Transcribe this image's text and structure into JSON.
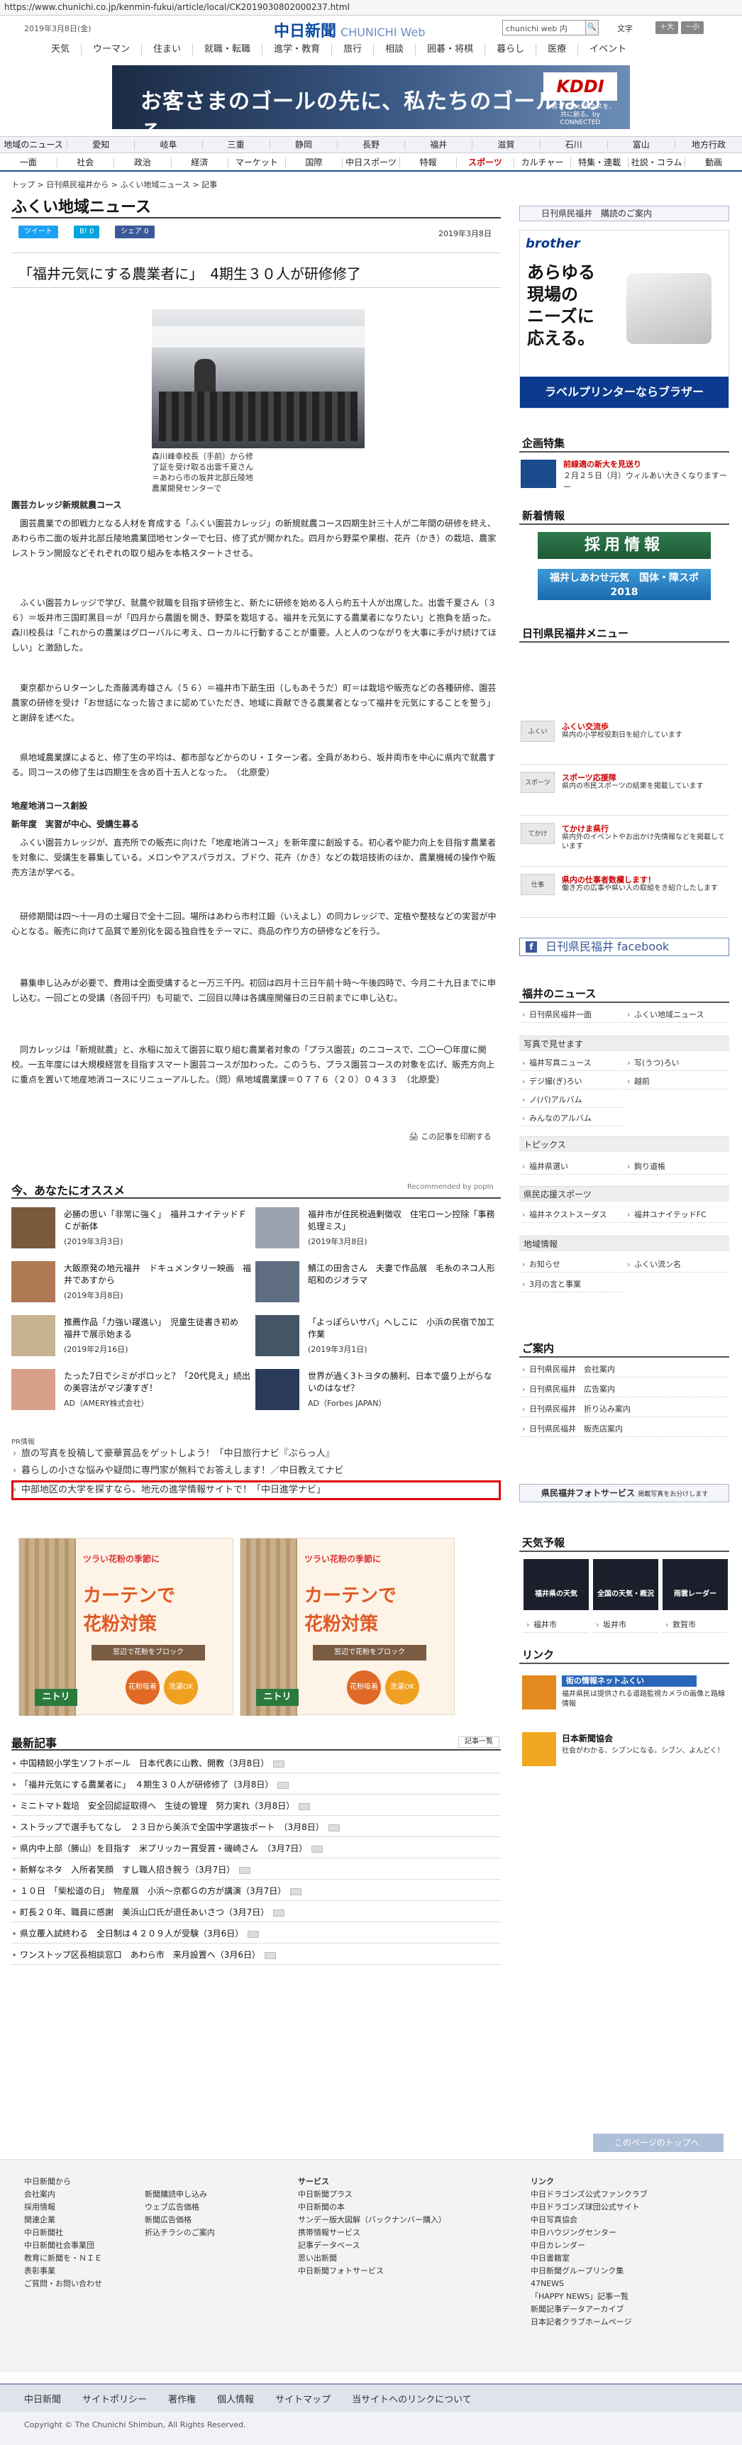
{
  "browser": {
    "url": "https://www.chunichi.co.jp/kenmin-fukui/article/local/CK2019030802000237.html"
  },
  "header": {
    "date": "2019年3月8日(金)",
    "logo_main": "中日新聞",
    "logo_sub": "CHUNICHI Web",
    "search_placeholder": "chunichi web 内",
    "search_btn": "🔍",
    "font_label": "文字",
    "font_big": "大",
    "font_small": "小",
    "nav": [
      "天気",
      "ウーマン",
      "住まい",
      "就職・転職",
      "進学・教育",
      "旅行",
      "相談",
      "囲碁・将棋",
      "暮らし",
      "医療",
      "イベント"
    ]
  },
  "ad_banner": {
    "text": "お客さまのゴールの先に、私たちのゴールはある。",
    "brand": "KDDI",
    "brand_sub": "お客さまのビジネスを、共に創る。by CONNECTED"
  },
  "region_nav": {
    "row1": [
      "地域のニュース",
      "愛知",
      "岐阜",
      "三重",
      "静岡",
      "長野",
      "福井",
      "滋賀",
      "石川",
      "富山",
      "地方行政"
    ],
    "row2": [
      "一面",
      "社会",
      "政治",
      "経済",
      "マーケット",
      "国際",
      "中日スポーツ",
      "特報",
      "スポーツ",
      "カルチャー",
      "特集・連載",
      "社説・コラム",
      "動画"
    ],
    "row2_active": "スポーツ"
  },
  "breadcrumb": "トップ > 日刊県民福井から > ふくい地域ニュース > 記事",
  "page_title": "ふくい地域ニュース",
  "share": {
    "tweet": "ツイート",
    "b": "B! 0",
    "fb": "シェア 0"
  },
  "article": {
    "date": "2019年3月8日",
    "title": "「福井元気にする農業者に」　4期生３０人が研修修了",
    "caption": "森川峰幸校長（手前）から修了証を受け取る出雲千夏さん＝あわら市の坂井北部丘陵地農業開発センターで",
    "sub1": "園芸カレッジ新規就農コース",
    "p1": "　園芸農業での即戦力となる人材を育成する「ふくい園芸カレッジ」の新規就農コース四期生計三十人が二年間の研修を終え、あわら市二面の坂井北部丘陵地農業団地センターで七日、修了式が開かれた。四月から野菜や果樹、花卉（かき）の栽培、農家レストラン開設などそれぞれの取り組みを本格スタートさせる。",
    "p2": "　ふくい園芸カレッジで学び、就農や就職を目指す研修生と、新たに研修を始める人ら約五十人が出席した。出雲千夏さん（３６）＝坂井市三国町黒目＝が「四月から農園を開き、野菜を栽培する。福井を元気にする農業者になりたい」と抱負を語った。森川校長は「これからの農業はグローバルに考え、ローカルに行動することが重要。人と人のつながりを大事に手がけ続けてほしい」と激励した。",
    "p3": "　東京都からＵターンした斎藤満寿雄さん（５６）＝福井市下莇生田（しもあそうだ）町＝は栽培や販売などの各種研修、園芸農家の研修を受け「お世話になった皆さまに認めていただき、地域に貢献できる農業者となって福井を元気にすることを誓う」と謝辞を述べた。",
    "p4": "　県地域農業課によると、修了生の平均は、都市部などからのＵ・Ｉターン者。全員があわら、坂井両市を中心に県内で就農する。同コースの修了生は四期生を含め百十五人となった。　（北原愛）",
    "sub2": "地産地消コース創設",
    "sub3": "新年度　実習が中心、受講生募る",
    "p5": "　ふくい園芸カレッジが、直売所での販売に向けた「地産地消コース」を新年度に創設する。初心者や能力向上を目指す農業者を対象に、受講生を募集している。メロンやアスパラガス、ブドウ、花卉（かき）などの栽培技術のほか、農業機械の操作や販売方法が学べる。",
    "p6": "　研修期間は四～十一月の土曜日で全十二回。場所はあわら市村江鍛（いえよし）の同カレッジで、定植や整枝などの実習が中心となる。販売に向けて品質で差別化を図る独自性をテーマに、商品の作り方の研修などを行う。",
    "p7": "　募集申し込みが必要で、費用は全面受講すると一万三千円。初回は四月十三日午前十時～午後四時で、今月二十九日までに申し込む。一回ごとの受講（各回千円）も可能で、二回目以降は各講座開催日の三日前までに申し込む。",
    "p8": "　同カレッジは「新規就農」と、水稲に加えて園芸に取り組む農業者対象の「プラス園芸」のニコースで、二〇一〇年度に開校。一五年度には大規模経営を目指すスマート園芸コースが加わった。このうち、プラス園芸コースの対象を広げ、販売方向上に重点を置いて地産地消コースにリニューアルした。（問）県地域農業課＝０７７６（２０）０４３３　（北原愛）",
    "print": "この記事を印刷する"
  },
  "reco": {
    "title": "今、あなたにオススメ",
    "by": "Recommended by popIn",
    "items": [
      {
        "t": "必勝の思い「非常に強く」　福井ユナイテッドＦＣが新体",
        "d": "(2019年3月3日)"
      },
      {
        "t": "福井市が住民税過剰徴収　住宅ローン控除「事務処理ミス」",
        "d": "(2019年3月8日)"
      },
      {
        "t": "大飯原発の地元福井　ドキュメンタリー映画　福井であすから",
        "d": "(2019年3月8日)"
      },
      {
        "t": "鯖江の田舎さん　夫妻で作品展　毛糸のネコ人形　昭和のジオラマ",
        "d": ""
      },
      {
        "t": "推薦作品「力強い躍進い」　児童生徒書き初め　福井で展示始まる",
        "d": "(2019年2月16日)"
      },
      {
        "t": "「よっぽらいサバ」へしこに　小浜の民宿で加工作業",
        "d": "(2019年3月1日)"
      },
      {
        "t": "たった7日でシミがポロッと？「20代見え」続出の美容法がマジ凄すぎ！",
        "d": "AD（AMERY株式会社）"
      },
      {
        "t": "世界が過く3トヨタの勝利、日本で盛り上がらないのはなぜ？",
        "d": "AD（Forbes JAPAN）"
      }
    ]
  },
  "pr": {
    "label": "PR情報",
    "lines": [
      "旅の写真を投稿して豪華賞品をゲットしよう！「中日旅行ナビ『ぶらっ人』",
      "暮らしの小さな悩みや疑問に専門家が無料でお答えします！／中日教えてナビ",
      "中部地区の大学を探すなら、地元の進学情報サイトで！「中日進学ナビ」"
    ]
  },
  "ads": {
    "t1": "ツラい花粉の季節に",
    "t2": "カーテンで",
    "t3": "花粉対策",
    "tag": "窓辺で花粉をブロック",
    "c1": "花粉吸着",
    "c2": "洗濯OK",
    "brand": "ニトリ"
  },
  "latest": {
    "title": "最新記事",
    "more": "記事一覧",
    "items": [
      "中国精鋭小学生ソフトボール　日本代表に山教、開教（3月8日）",
      "「福井元気にする農業者に」　４期生３０人が研修修了（3月8日）",
      "ミニトマト栽培　安全回認証取得へ　生徒の管理　努力実れ（3月8日）",
      "ストラップで選手もてなし　２３日から美浜で全国中学選抜ポート　（3月8日）",
      "県内中上部（勝山）を目指す　米プリッカー賞受賞・磯崎さん　（3月7日）",
      "新鮮なネタ　入所者笑顔　すし職人招き腕う（3月7日）",
      "１０日　「柴松道の日」　物産展　小浜～京都Ｇの方が講演（3月7日）",
      "町長２０年、職員に感謝　美浜山口氏が退任あいさつ（3月7日）",
      "県立覆入試終わる　全日制は４２０９人が受験（3月6日）",
      "ワンストップ区長相談窓口　あわら市　来月設置へ（3月6日）"
    ]
  },
  "right": {
    "kenmin": "日刊県民福井　購読のご案内",
    "brother": {
      "brand": "brother",
      "line1": "あらゆる",
      "line2": "現場の",
      "line3": "ニーズに",
      "line4": "応える。",
      "bottom": "ラベルプリンターならブラザー"
    },
    "kikaku": "企画特集",
    "kikaku_item": {
      "title": "前線適の新大を見送り",
      "desc": "２月２５日（月）ウィルあい大きくなりますーー"
    },
    "shinsyun": "新着情報",
    "saiyou": "採用情報",
    "ad2": "福井しあわせ元気　国体・障スポ2018",
    "menu_title": "日刊県民福井メニュー",
    "menu": [
      {
        "i": "ふくい",
        "t": "ふくい交流歩",
        "d": "県内の小学校役割日を紹介しています"
      },
      {
        "i": "スポーツ",
        "t": "スポーツ応援隊",
        "d": "県内の市民スポーツの結果を掲載しています"
      },
      {
        "i": "てかけ",
        "t": "てかけま県行",
        "d": "県内外のイベントやお出かけ先情報などを掲載しています"
      },
      {
        "i": "仕事",
        "t": "県内の仕事者数欄します！",
        "d": "働き方の広事や県い人の取組をき紹介したします"
      }
    ],
    "fb": "日刊県民福井 facebook",
    "news_title": "福井のニュース",
    "news_links": [
      "日刊県民福井一面",
      "ふくい地域ニュース"
    ],
    "photo_sec": "写真で見せます",
    "photo_links": [
      "福井写真ニュース",
      "写(うつ)ろい",
      "デジ撮(ぎ)ろい",
      "越前",
      "ノ(パ)アルバム"
    ],
    "photo_links2": "みんなのアルバム",
    "topics": "トピックス",
    "topics_links": [
      "福井県選い",
      "鉤り道帳"
    ],
    "sport": "県民応援スポーツ",
    "sport_links": [
      "福井ネクストスーダス",
      "福井ユナイテッドFC"
    ],
    "region": "地域情報",
    "region_links": [
      "お知らせ",
      "ふくい流ン名",
      "3月の言と事業"
    ],
    "guide": "ご案内",
    "guide_links": [
      "日刊県民福井　会社案内",
      "日刊県民福井　広告案内",
      "日刊県民福井　折り込み案内",
      "日刊県民福井　販売店案内"
    ],
    "photo_service": "県民福井フォトサービス",
    "photo_service_sub": "掲載写真をお分けします",
    "tenki": "天気予報",
    "weather": [
      "福井県の天気",
      "全国の天気・概況",
      "雨雲レーダー"
    ],
    "weather_links": [
      "福井市",
      "坂井市",
      "敦賀市"
    ],
    "link": "リンク",
    "links": [
      {
        "t": "街の情報ネットふくい",
        "d": "福井県民は提供される道路監視カメラの画像と路線情報"
      },
      {
        "t": "日本新聞協会",
        "d": "社会がわかる、シブンになる。シブン、よんどく！"
      }
    ]
  },
  "pagetop": "このページのトップへ",
  "footer": {
    "col1": [
      "中日新聞から",
      "会社案内",
      "採用情報",
      "関連企業",
      "中日新聞社",
      "中日新聞社会事業団",
      "教育に新聞を・ＮＩＥ",
      "表彰事業",
      "ご質問・お問い合わせ"
    ],
    "col2": [
      "新聞購読申し込み",
      "ウェブ広告価格",
      "新聞広告価格",
      "折込チラシのご案内"
    ],
    "col3": [
      "サービス",
      "中日新聞プラス",
      "中日新聞の本",
      "サンデー版大図解（バックナンバー購入）",
      "携帯情報サービス",
      "記事データベース",
      "思い出新聞",
      "中日新聞フォトサービス"
    ],
    "col4": [
      "リンク",
      "中日ドラゴンズ公式ファンクラブ",
      "中日ドラゴンズ球団公式サイト",
      "中日写真協会",
      "中日ハウジングセンター",
      "中日カレンダー",
      "中日書籍室",
      "中日新聞グループリンク集",
      "47NEWS",
      "「HAPPY NEWS」記事一覧",
      "新聞記事データアーカイブ",
      "日本記者クラブホームページ"
    ],
    "bottom_links": [
      "中日新聞",
      "サイトポリシー",
      "著作権",
      "個人情報",
      "サイトマップ",
      "当サイトへのリンクについて"
    ],
    "copyright": "Copyright © The Chunichi Shimbun, All Rights Reserved."
  }
}
